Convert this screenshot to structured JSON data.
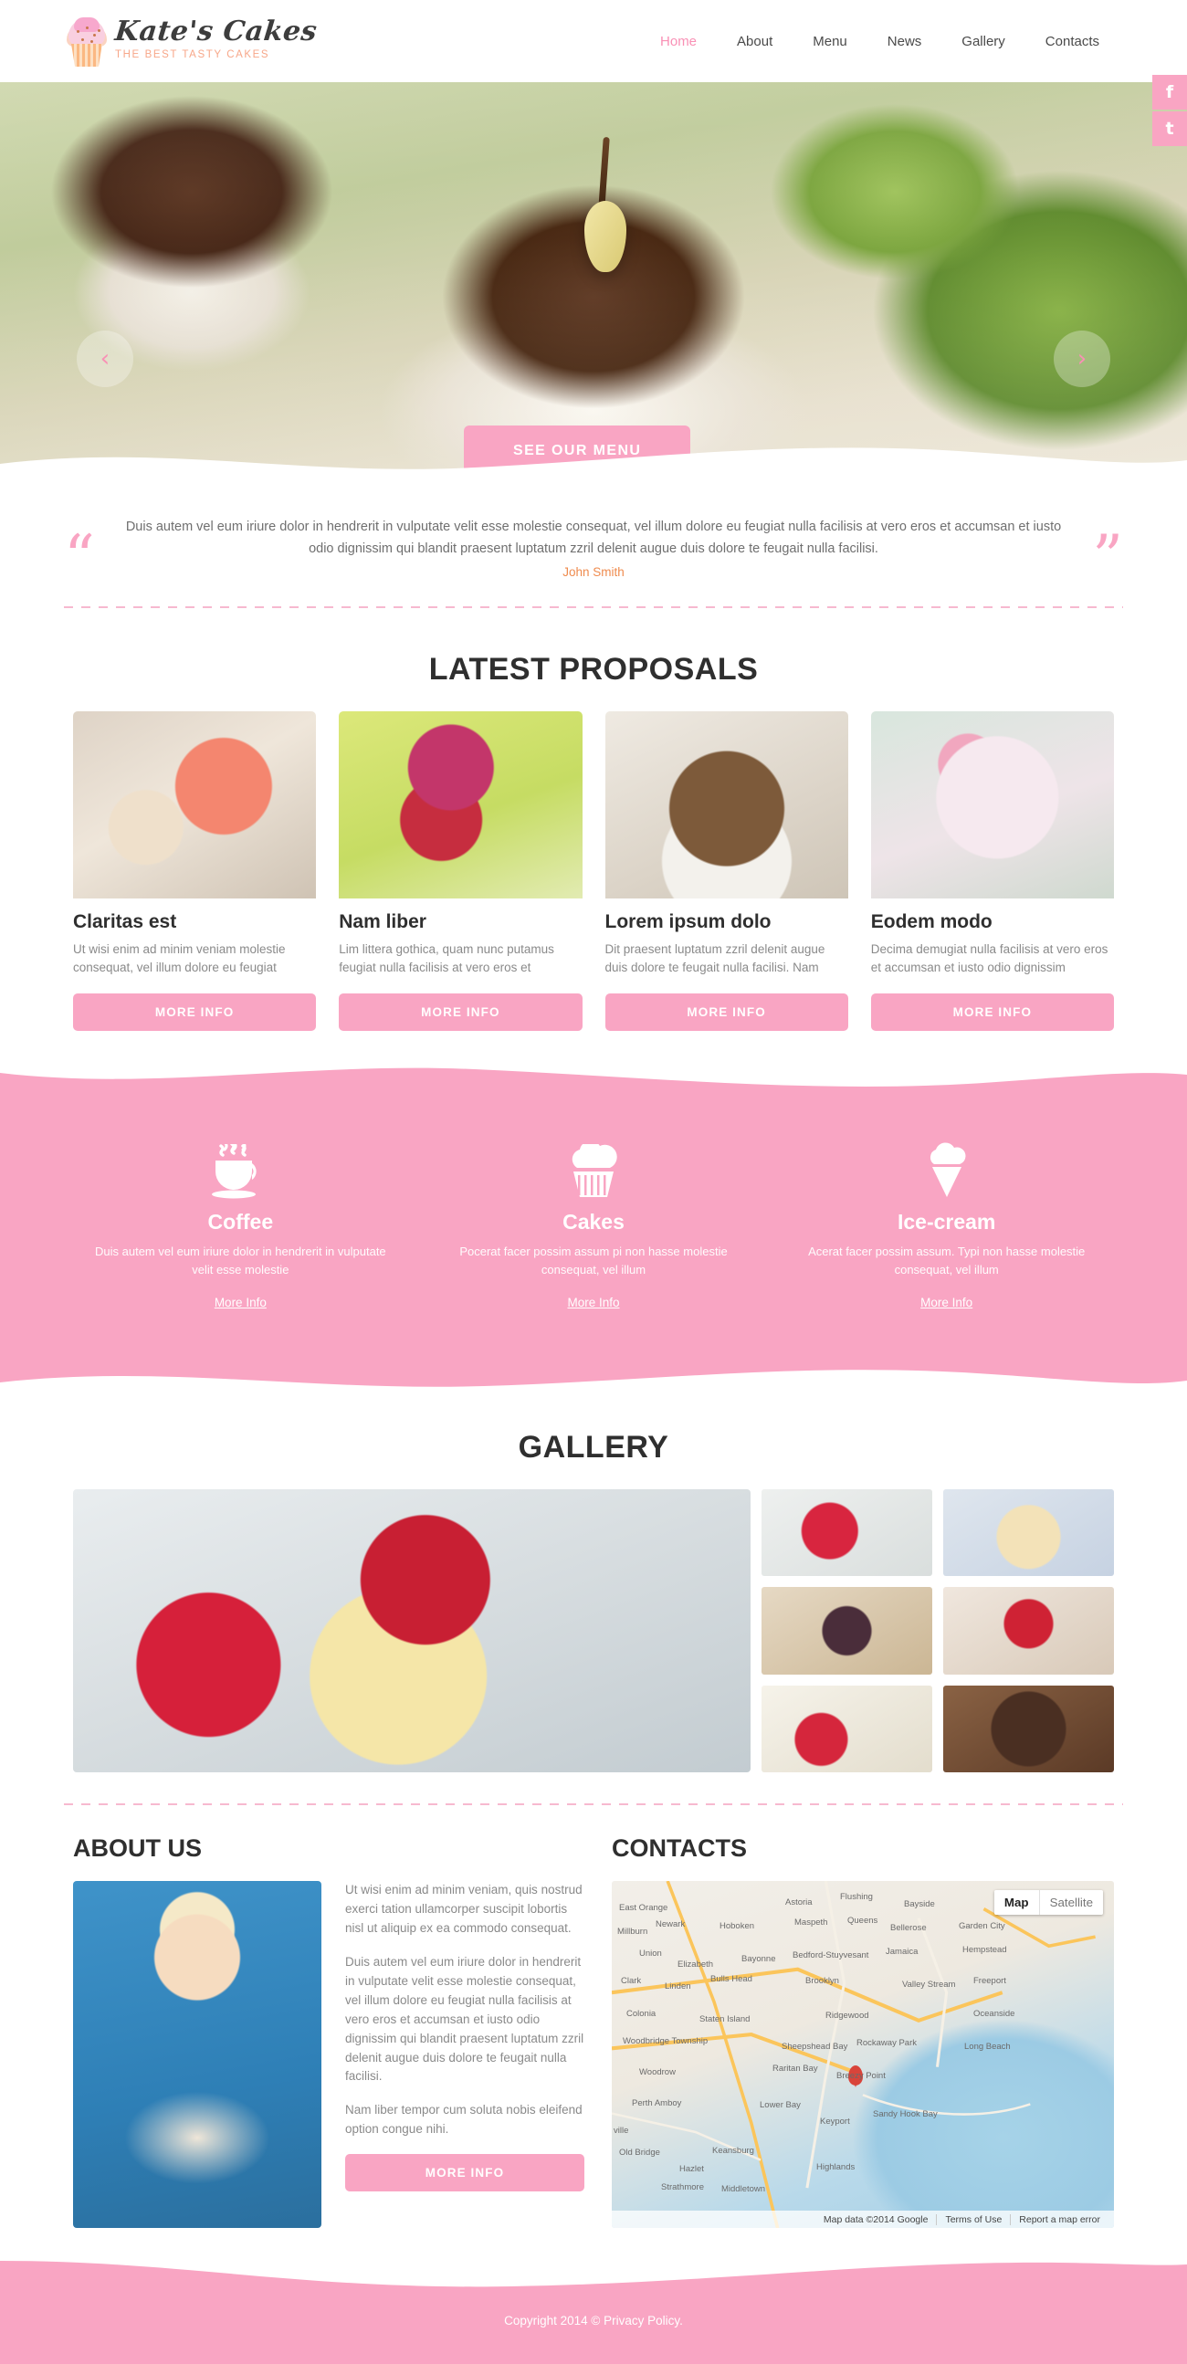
{
  "header": {
    "logo_name": "Kate's Cakes",
    "logo_tagline": "THE BEST TASTY CAKES",
    "nav": [
      {
        "label": "Home",
        "active": true
      },
      {
        "label": "About",
        "active": false
      },
      {
        "label": "Menu",
        "active": false
      },
      {
        "label": "News",
        "active": false
      },
      {
        "label": "Gallery",
        "active": false
      },
      {
        "label": "Contacts",
        "active": false
      }
    ]
  },
  "social": [
    {
      "name": "facebook",
      "glyph": "f"
    },
    {
      "name": "twitter",
      "glyph": "t"
    }
  ],
  "hero": {
    "cta_label": "SEE OUR MENU",
    "prev_glyph": "‹",
    "next_glyph": "›"
  },
  "quote": {
    "open_mark": "“",
    "close_mark": "”",
    "text": "Duis autem vel eum iriure dolor in hendrerit in vulputate velit esse molestie consequat, vel illum dolore eu feugiat nulla facilisis at vero eros et accumsan et iusto odio dignissim qui blandit praesent luptatum zzril delenit augue duis dolore te feugait nulla facilisi.",
    "author": "John Smith"
  },
  "proposals": {
    "title": "LATEST PROPOSALS",
    "button_label": "MORE INFO",
    "items": [
      {
        "title": "Claritas est",
        "text": "Ut wisi enim ad minim veniam molestie consequat, vel illum dolore eu feugiat",
        "button": "MORE INFO"
      },
      {
        "title": "Nam liber",
        "text": "Lim littera gothica, quam nunc putamus feugiat nulla facilisis at vero eros et",
        "button": "MORE INFO"
      },
      {
        "title": "Lorem ipsum dolo",
        "text": "Dit praesent luptatum zzril delenit augue duis dolore te feugait nulla facilisi. Nam",
        "button": "MORE INFO"
      },
      {
        "title": "Eodem modo",
        "text": "Decima demugiat nulla facilisis at vero eros et accumsan et iusto odio dignissim",
        "button": "MORE INFO"
      }
    ]
  },
  "services": [
    {
      "icon": "coffee-cup-icon",
      "title": "Coffee",
      "text": "Duis autem vel eum iriure dolor in hendrerit in vulputate velit esse molestie",
      "link": "More Info"
    },
    {
      "icon": "cupcake-icon",
      "title": "Cakes",
      "text": "Pocerat facer possim assum pi non hasse molestie consequat, vel illum",
      "link": "More Info"
    },
    {
      "icon": "ice-cream-cone-icon",
      "title": "Ice-cream",
      "text": "Acerat facer possim assum. Typi non hasse molestie consequat, vel illum",
      "link": "More Info"
    }
  ],
  "gallery": {
    "title": "GALLERY"
  },
  "about": {
    "title": "ABOUT US",
    "p1": "Ut wisi enim ad minim veniam, quis nostrud exerci tation ullamcorper suscipit lobortis nisl ut aliquip ex ea commodo consequat.",
    "p2": "Duis autem vel eum iriure dolor in hendrerit in vulputate velit esse molestie consequat, vel illum dolore eu feugiat nulla facilisis at vero eros et accumsan et iusto odio dignissim qui blandit praesent luptatum zzril delenit augue duis dolore te feugait nulla facilisi.",
    "p3": "Nam liber tempor cum soluta nobis eleifend option congue nihi.",
    "button": "MORE INFO"
  },
  "contacts": {
    "title": "CONTACTS",
    "map": {
      "control_map": "Map",
      "control_satellite": "Satellite",
      "attribution": "Map data ©2014 Google",
      "terms": "Terms of Use",
      "report": "Report a map error",
      "labels": [
        "East Orange",
        "Astoria",
        "Flushing",
        "Bayside",
        "Millburn",
        "Newark",
        "Hoboken",
        "Maspeth",
        "Queens",
        "Bellerose",
        "Garden City",
        "Union",
        "Elizabeth",
        "Bayonne",
        "Bedford-Stuyvesant",
        "Jamaica",
        "Hempstead",
        "Clark",
        "Linden",
        "Bulls Head",
        "Brooklyn",
        "Valley Stream",
        "Freeport",
        "Colonia",
        "Staten Island",
        "Ridgewood",
        "Oceanside",
        "Woodbridge Township",
        "Sheepshead Bay",
        "Rockaway Park",
        "Long Beach",
        "Woodrow",
        "Raritan Bay",
        "Breezy Point",
        "Perth Amboy",
        "Lower Bay",
        "Keyport",
        "Sandy Hook Bay",
        "ville",
        "Old Bridge",
        "Keansburg",
        "Hazlet",
        "Highlands",
        "Strathmore",
        "Middletown"
      ]
    }
  },
  "footer": {
    "copyright": "Copyright 2014 © ",
    "privacy": "Privacy Policy."
  },
  "colors": {
    "pink": "#f9a5c3",
    "pink_soft": "#f990b5",
    "orange": "#ef8b4e",
    "peach": "#f7a789",
    "dark": "#2f2f2f"
  }
}
